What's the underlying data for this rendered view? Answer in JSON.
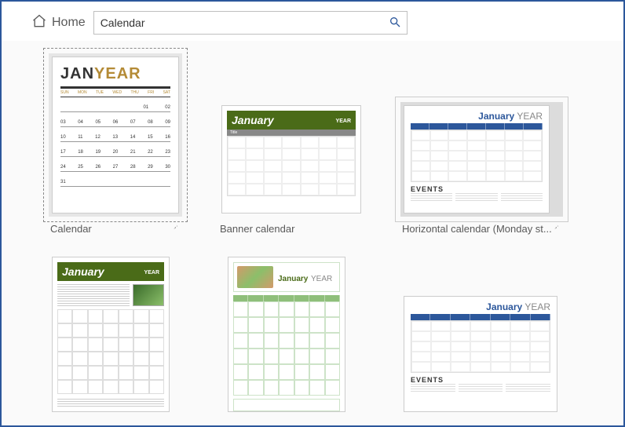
{
  "header": {
    "home_label": "Home"
  },
  "search": {
    "value": "Calendar"
  },
  "templates": [
    {
      "label": "Calendar",
      "pinned": true
    },
    {
      "label": "Banner calendar",
      "pinned": false
    },
    {
      "label": "Horizontal calendar (Monday st...",
      "pinned": true
    },
    {
      "label": "",
      "pinned": false
    },
    {
      "label": "",
      "pinned": false
    },
    {
      "label": "",
      "pinned": false
    }
  ],
  "thumb_text": {
    "jan": "JAN",
    "year": "YEAR",
    "january": "January",
    "events": "EVENTS",
    "title_word": "Title",
    "dow_short": [
      "SUN",
      "MON",
      "TUE",
      "WED",
      "THU",
      "FRI",
      "SAT"
    ],
    "weeks_t1": [
      [
        "",
        "",
        "",
        "",
        "",
        "01",
        "02"
      ],
      [
        "03",
        "04",
        "05",
        "06",
        "07",
        "08",
        "09"
      ],
      [
        "10",
        "11",
        "12",
        "13",
        "14",
        "15",
        "16"
      ],
      [
        "17",
        "18",
        "19",
        "20",
        "21",
        "22",
        "23"
      ],
      [
        "24",
        "25",
        "26",
        "27",
        "28",
        "29",
        "30"
      ],
      [
        "31",
        "",
        "",
        "",
        "",
        "",
        ""
      ]
    ]
  }
}
